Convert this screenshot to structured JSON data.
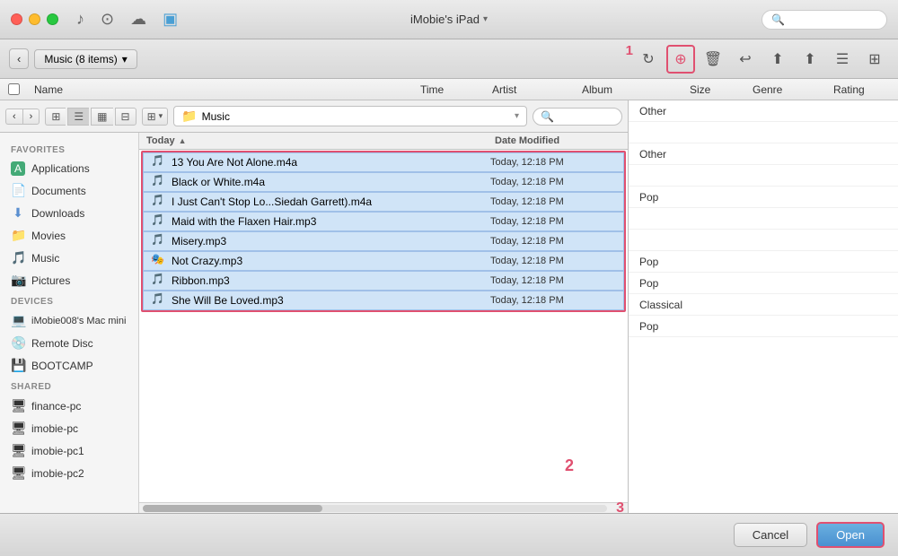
{
  "titleBar": {
    "title": "iMobie's iPad",
    "searchPlaceholder": ""
  },
  "toolbar": {
    "breadcrumb": "Music (8 items)",
    "breadcrumbDropdown": "▾"
  },
  "columns": {
    "name": "Name",
    "time": "Time",
    "artist": "Artist",
    "album": "Album",
    "size": "Size",
    "genre": "Genre",
    "rating": "Rating"
  },
  "fileBrowser": {
    "location": "Music",
    "headers": {
      "today": "Today",
      "dateModified": "Date Modified"
    },
    "files": [
      {
        "name": "13 You Are Not Alone.m4a",
        "date": "Today, 12:18 PM",
        "icon": "🎵",
        "type": "m4a"
      },
      {
        "name": "Black or White.m4a",
        "date": "Today, 12:18 PM",
        "icon": "🎵",
        "type": "m4a"
      },
      {
        "name": "I Just Can't Stop Lo...Siedah Garrett).m4a",
        "date": "Today, 12:18 PM",
        "icon": "🎵",
        "type": "m4a"
      },
      {
        "name": "Maid with the Flaxen Hair.mp3",
        "date": "Today, 12:18 PM",
        "icon": "🎵",
        "type": "mp3"
      },
      {
        "name": "Misery.mp3",
        "date": "Today, 12:18 PM",
        "icon": "🎸",
        "type": "mp3"
      },
      {
        "name": "Not Crazy.mp3",
        "date": "Today, 12:18 PM",
        "icon": "🎭",
        "type": "mp3"
      },
      {
        "name": "Ribbon.mp3",
        "date": "Today, 12:18 PM",
        "icon": "🎵",
        "type": "mp3"
      },
      {
        "name": "She Will Be Loved.mp3",
        "date": "Today, 12:18 PM",
        "icon": "🎵",
        "type": "mp3"
      }
    ]
  },
  "sidebar": {
    "sections": [
      {
        "header": "FAVORITES",
        "items": [
          {
            "label": "Applications",
            "icon": "🅰",
            "iconType": "app"
          },
          {
            "label": "Documents",
            "icon": "📄",
            "iconType": "doc"
          },
          {
            "label": "Downloads",
            "icon": "⬇",
            "iconType": "dl"
          },
          {
            "label": "Movies",
            "icon": "📁",
            "iconType": "folder"
          },
          {
            "label": "Music",
            "icon": "🎵",
            "iconType": "music"
          },
          {
            "label": "Pictures",
            "icon": "📷",
            "iconType": "pic"
          }
        ]
      },
      {
        "header": "DEVICES",
        "items": [
          {
            "label": "iMobie008's Mac mini",
            "icon": "💻",
            "iconType": "mac"
          },
          {
            "label": "Remote Disc",
            "icon": "💿",
            "iconType": "disc"
          },
          {
            "label": "BOOTCAMP",
            "icon": "💾",
            "iconType": "drive"
          }
        ]
      },
      {
        "header": "SHARED",
        "items": [
          {
            "label": "finance-pc",
            "icon": "🖥",
            "iconType": "pc"
          },
          {
            "label": "imobie-pc",
            "icon": "🖥",
            "iconType": "pc"
          },
          {
            "label": "imobie-pc1",
            "icon": "🖥",
            "iconType": "pc"
          },
          {
            "label": "imobie-pc2",
            "icon": "🖥",
            "iconType": "pc"
          }
        ]
      }
    ]
  },
  "rightPanel": {
    "genreRows": [
      {
        "genre": "Other",
        "rating": ""
      },
      {
        "genre": "",
        "rating": ""
      },
      {
        "genre": "Other",
        "rating": ""
      },
      {
        "genre": "",
        "rating": ""
      },
      {
        "genre": "Pop",
        "rating": ""
      },
      {
        "genre": "",
        "rating": ""
      },
      {
        "genre": "",
        "rating": ""
      },
      {
        "genre": "Pop",
        "rating": ""
      },
      {
        "genre": "Pop",
        "rating": ""
      },
      {
        "genre": "Classical",
        "rating": ""
      },
      {
        "genre": "Pop",
        "rating": ""
      }
    ]
  },
  "badges": {
    "badge1": "1",
    "badge2": "2",
    "badge3": "3"
  },
  "buttons": {
    "cancel": "Cancel",
    "open": "Open"
  }
}
